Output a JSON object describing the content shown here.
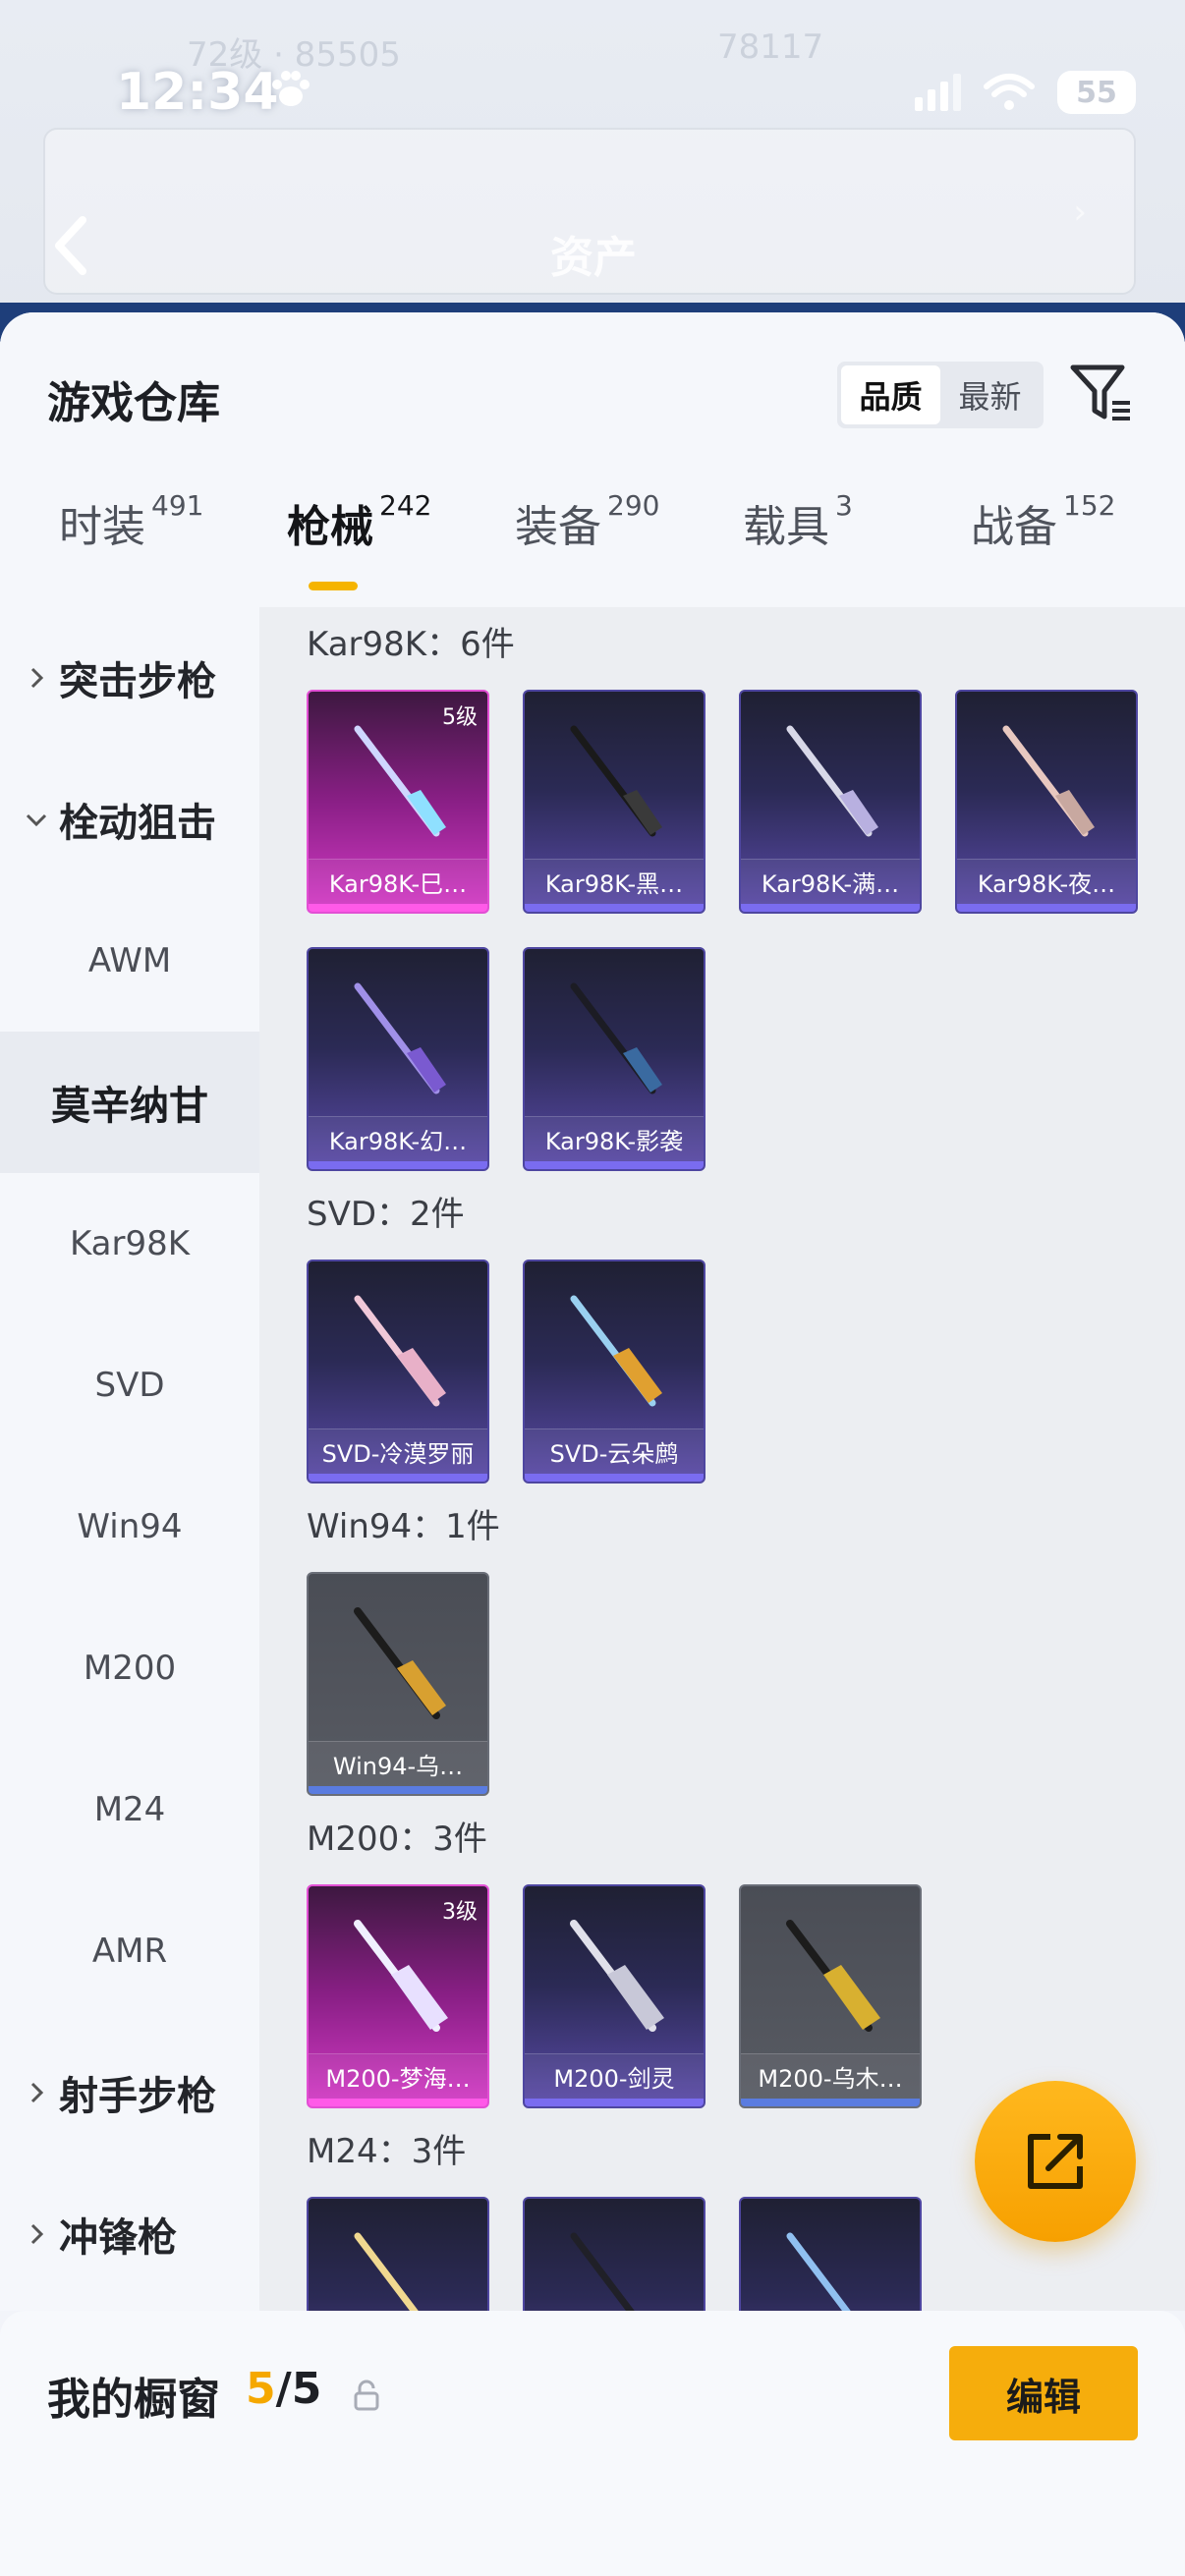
{
  "status_bar": {
    "time": "12:34",
    "battery": "55"
  },
  "header": {
    "title": "资产"
  },
  "sheet": {
    "title": "游戏仓库",
    "sort_options": [
      "品质",
      "最新"
    ],
    "active_sort": "品质"
  },
  "tabs": [
    {
      "label": "时装",
      "count": "491"
    },
    {
      "label": "枪械",
      "count": "242"
    },
    {
      "label": "装备",
      "count": "290"
    },
    {
      "label": "载具",
      "count": "3"
    },
    {
      "label": "战备",
      "count": "152"
    }
  ],
  "active_tab": "枪械",
  "sidebar": {
    "groups": [
      {
        "label": "突击步枪",
        "expanded": false
      },
      {
        "label": "栓动狙击",
        "expanded": true
      },
      {
        "label": "射手步枪",
        "expanded": false
      },
      {
        "label": "冲锋枪",
        "expanded": false
      }
    ],
    "items": [
      "AWM",
      "莫辛纳甘",
      "Kar98K",
      "SVD",
      "Win94",
      "M200",
      "M24",
      "AMR"
    ],
    "selected": "莫辛纳甘"
  },
  "sections": [
    {
      "title": "Kar98K：6件",
      "items": [
        {
          "name": "Kar98K-巳…",
          "rarity": "pink",
          "level": "5级"
        },
        {
          "name": "Kar98K-黑…",
          "rarity": "purple"
        },
        {
          "name": "Kar98K-满…",
          "rarity": "purple"
        },
        {
          "name": "Kar98K-夜…",
          "rarity": "purple"
        },
        {
          "name": "Kar98K-幻…",
          "rarity": "purple"
        },
        {
          "name": "Kar98K-影袭",
          "rarity": "purple"
        }
      ]
    },
    {
      "title": "SVD：2件",
      "items": [
        {
          "name": "SVD-冷漠罗丽",
          "rarity": "purple"
        },
        {
          "name": "SVD-云朵鹧",
          "rarity": "purple"
        }
      ]
    },
    {
      "title": "Win94：1件",
      "items": [
        {
          "name": "Win94-乌…",
          "rarity": "grey"
        }
      ]
    },
    {
      "title": "M200：3件",
      "items": [
        {
          "name": "M200-梦海…",
          "rarity": "pink",
          "level": "3级"
        },
        {
          "name": "M200-剑灵",
          "rarity": "purple"
        },
        {
          "name": "M200-乌木…",
          "rarity": "grey"
        }
      ]
    },
    {
      "title": "M24：3件",
      "items": [
        {
          "name": "",
          "rarity": "purple"
        },
        {
          "name": "",
          "rarity": "purple"
        },
        {
          "name": "",
          "rarity": "purple"
        }
      ]
    }
  ],
  "showcase": {
    "label": "我的橱窗",
    "current": "5",
    "separator": "/",
    "total": "5",
    "edit_label": "编辑"
  },
  "colors": {
    "accent": "#f6ad0c",
    "pink_rarity": "#d43bc6",
    "purple_rarity": "#5a4aa8",
    "grey_rarity": "#585b63"
  },
  "icons": [
    "paw-icon",
    "signal-icon",
    "wifi-icon",
    "battery-icon",
    "back-chevron-icon",
    "filter-icon",
    "chevron-right-icon",
    "chevron-down-icon",
    "gun-icon",
    "share-icon",
    "lock-icon"
  ]
}
